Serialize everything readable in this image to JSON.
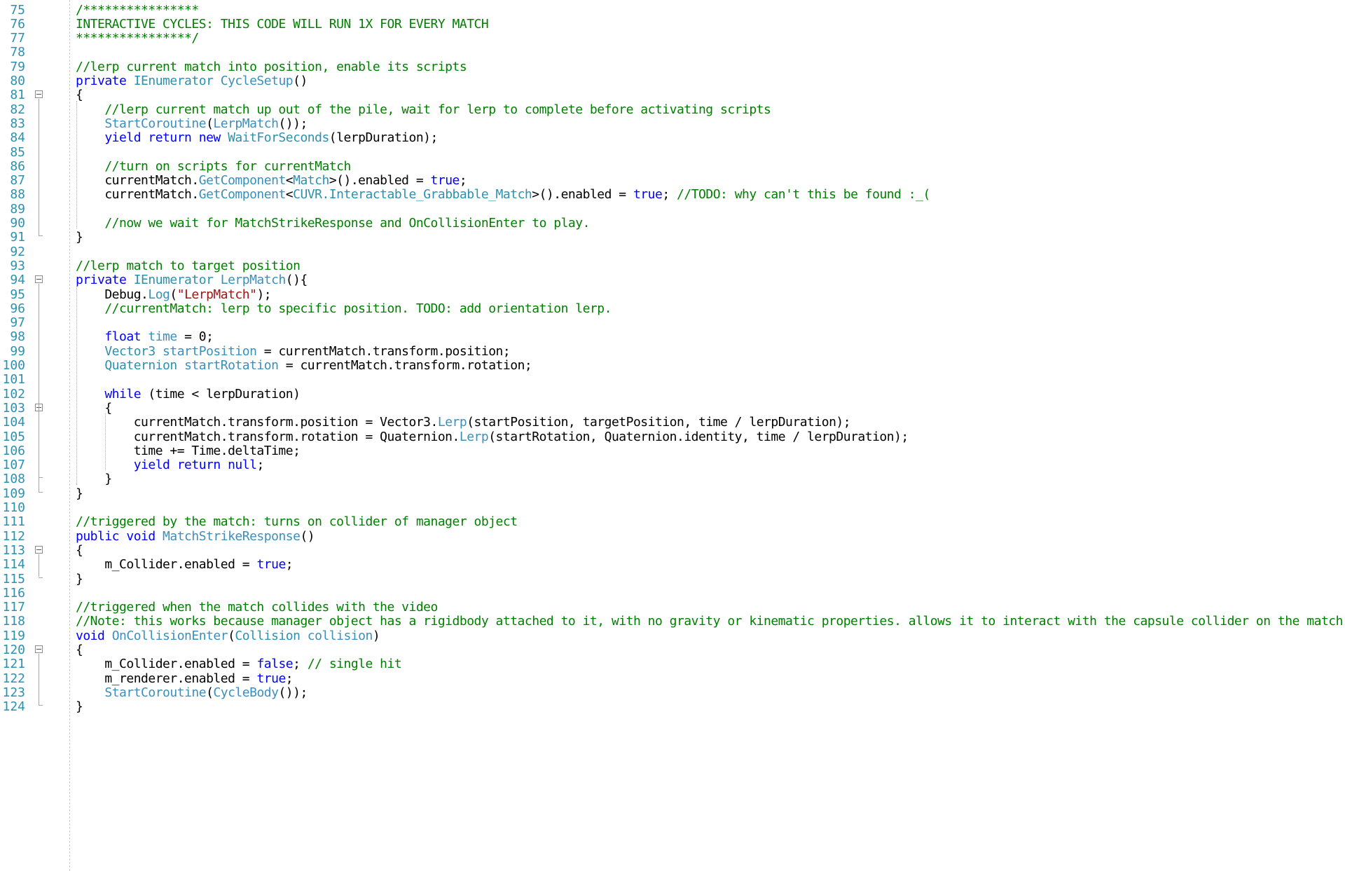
{
  "editor": {
    "lines": [
      {
        "num": "75",
        "fold": false,
        "tokens": [
          {
            "c": "c",
            "t": "/****************"
          }
        ]
      },
      {
        "num": "76",
        "fold": false,
        "tokens": [
          {
            "c": "c",
            "t": "INTERACTIVE CYCLES: THIS CODE WILL RUN 1X FOR EVERY MATCH"
          }
        ]
      },
      {
        "num": "77",
        "fold": false,
        "tokens": [
          {
            "c": "c",
            "t": "****************/"
          }
        ]
      },
      {
        "num": "78",
        "fold": false,
        "tokens": []
      },
      {
        "num": "79",
        "fold": false,
        "tokens": [
          {
            "c": "c",
            "t": "//lerp current match into position, enable its scripts"
          }
        ]
      },
      {
        "num": "80",
        "fold": false,
        "tokens": [
          {
            "c": "k",
            "t": "private "
          },
          {
            "c": "t",
            "t": "IEnumerator "
          },
          {
            "c": "m",
            "t": "CycleSetup"
          },
          {
            "c": "p",
            "t": "()"
          }
        ]
      },
      {
        "num": "81",
        "fold": true,
        "tokens": [
          {
            "c": "p",
            "t": "{"
          }
        ]
      },
      {
        "num": "82",
        "fold": false,
        "tokens": [
          {
            "c": "c",
            "t": "    //lerp current match up out of the pile, wait for lerp to complete before activating scripts"
          }
        ]
      },
      {
        "num": "83",
        "fold": false,
        "tokens": [
          {
            "c": "p",
            "t": "    "
          },
          {
            "c": "m",
            "t": "StartCoroutine"
          },
          {
            "c": "p",
            "t": "("
          },
          {
            "c": "m",
            "t": "LerpMatch"
          },
          {
            "c": "p",
            "t": "());"
          }
        ]
      },
      {
        "num": "84",
        "fold": false,
        "tokens": [
          {
            "c": "k",
            "t": "    yield return new "
          },
          {
            "c": "t",
            "t": "WaitForSeconds"
          },
          {
            "c": "p",
            "t": "(lerpDuration);"
          }
        ]
      },
      {
        "num": "85",
        "fold": false,
        "tokens": []
      },
      {
        "num": "86",
        "fold": false,
        "tokens": [
          {
            "c": "c",
            "t": "    //turn on scripts for currentMatch"
          }
        ]
      },
      {
        "num": "87",
        "fold": false,
        "tokens": [
          {
            "c": "p",
            "t": "    currentMatch."
          },
          {
            "c": "m",
            "t": "GetComponent"
          },
          {
            "c": "p",
            "t": "<"
          },
          {
            "c": "t",
            "t": "Match"
          },
          {
            "c": "p",
            "t": ">().enabled = "
          },
          {
            "c": "k",
            "t": "true"
          },
          {
            "c": "p",
            "t": ";"
          }
        ]
      },
      {
        "num": "88",
        "fold": false,
        "tokens": [
          {
            "c": "p",
            "t": "    currentMatch."
          },
          {
            "c": "m",
            "t": "GetComponent"
          },
          {
            "c": "p",
            "t": "<"
          },
          {
            "c": "t",
            "t": "CUVR.Interactable_Grabbable_Match"
          },
          {
            "c": "p",
            "t": ">().enabled = "
          },
          {
            "c": "k",
            "t": "true"
          },
          {
            "c": "p",
            "t": "; "
          },
          {
            "c": "c",
            "t": "//TODO: why can't this be found :_("
          }
        ]
      },
      {
        "num": "89",
        "fold": false,
        "tokens": []
      },
      {
        "num": "90",
        "fold": false,
        "tokens": [
          {
            "c": "c",
            "t": "    //now we wait for MatchStrikeResponse and OnCollisionEnter to play."
          }
        ]
      },
      {
        "num": "91",
        "fold": false,
        "tokens": [
          {
            "c": "p",
            "t": "}"
          }
        ]
      },
      {
        "num": "92",
        "fold": false,
        "tokens": []
      },
      {
        "num": "93",
        "fold": false,
        "tokens": [
          {
            "c": "c",
            "t": "//lerp match to target position"
          }
        ]
      },
      {
        "num": "94",
        "fold": true,
        "tokens": [
          {
            "c": "k",
            "t": "private "
          },
          {
            "c": "t",
            "t": "IEnumerator "
          },
          {
            "c": "m",
            "t": "LerpMatch"
          },
          {
            "c": "p",
            "t": "(){"
          }
        ]
      },
      {
        "num": "95",
        "fold": false,
        "tokens": [
          {
            "c": "p",
            "t": "    Debug."
          },
          {
            "c": "m",
            "t": "Log"
          },
          {
            "c": "p",
            "t": "("
          },
          {
            "c": "s",
            "t": "\"LerpMatch\""
          },
          {
            "c": "p",
            "t": ");"
          }
        ]
      },
      {
        "num": "96",
        "fold": false,
        "tokens": [
          {
            "c": "c",
            "t": "    //currentMatch: lerp to specific position. TODO: add orientation lerp."
          }
        ]
      },
      {
        "num": "97",
        "fold": false,
        "tokens": []
      },
      {
        "num": "98",
        "fold": false,
        "tokens": [
          {
            "c": "k",
            "t": "    float "
          },
          {
            "c": "m",
            "t": "time"
          },
          {
            "c": "p",
            "t": " = 0;"
          }
        ]
      },
      {
        "num": "99",
        "fold": false,
        "tokens": [
          {
            "c": "t",
            "t": "    Vector3 "
          },
          {
            "c": "m",
            "t": "startPosition"
          },
          {
            "c": "p",
            "t": " = currentMatch.transform.position;"
          }
        ]
      },
      {
        "num": "100",
        "fold": false,
        "tokens": [
          {
            "c": "t",
            "t": "    Quaternion "
          },
          {
            "c": "m",
            "t": "startRotation"
          },
          {
            "c": "p",
            "t": " = currentMatch.transform.rotation;"
          }
        ]
      },
      {
        "num": "101",
        "fold": false,
        "tokens": []
      },
      {
        "num": "102",
        "fold": false,
        "tokens": [
          {
            "c": "k",
            "t": "    while "
          },
          {
            "c": "p",
            "t": "(time < lerpDuration)"
          }
        ]
      },
      {
        "num": "103",
        "fold": true,
        "tokens": [
          {
            "c": "p",
            "t": "    {"
          }
        ]
      },
      {
        "num": "104",
        "fold": false,
        "tokens": [
          {
            "c": "p",
            "t": "        currentMatch.transform.position = Vector3."
          },
          {
            "c": "m",
            "t": "Lerp"
          },
          {
            "c": "p",
            "t": "(startPosition, targetPosition, time / lerpDuration);"
          }
        ]
      },
      {
        "num": "105",
        "fold": false,
        "tokens": [
          {
            "c": "p",
            "t": "        currentMatch.transform.rotation = Quaternion."
          },
          {
            "c": "m",
            "t": "Lerp"
          },
          {
            "c": "p",
            "t": "(startRotation, Quaternion.identity, time / lerpDuration);"
          }
        ]
      },
      {
        "num": "106",
        "fold": false,
        "tokens": [
          {
            "c": "p",
            "t": "        time += Time.deltaTime;"
          }
        ]
      },
      {
        "num": "107",
        "fold": false,
        "tokens": [
          {
            "c": "k",
            "t": "        yield return null"
          },
          {
            "c": "p",
            "t": ";"
          }
        ]
      },
      {
        "num": "108",
        "fold": false,
        "tokens": [
          {
            "c": "p",
            "t": "    }"
          }
        ]
      },
      {
        "num": "109",
        "fold": false,
        "tokens": [
          {
            "c": "p",
            "t": "}"
          }
        ]
      },
      {
        "num": "110",
        "fold": false,
        "tokens": []
      },
      {
        "num": "111",
        "fold": false,
        "tokens": [
          {
            "c": "c",
            "t": "//triggered by the match: turns on collider of manager object"
          }
        ]
      },
      {
        "num": "112",
        "fold": false,
        "tokens": [
          {
            "c": "k",
            "t": "public void "
          },
          {
            "c": "m",
            "t": "MatchStrikeResponse"
          },
          {
            "c": "p",
            "t": "()"
          }
        ]
      },
      {
        "num": "113",
        "fold": true,
        "tokens": [
          {
            "c": "p",
            "t": "{"
          }
        ]
      },
      {
        "num": "114",
        "fold": false,
        "tokens": [
          {
            "c": "p",
            "t": "    m_Collider.enabled = "
          },
          {
            "c": "k",
            "t": "true"
          },
          {
            "c": "p",
            "t": ";"
          }
        ]
      },
      {
        "num": "115",
        "fold": false,
        "tokens": [
          {
            "c": "p",
            "t": "}"
          }
        ]
      },
      {
        "num": "116",
        "fold": false,
        "tokens": []
      },
      {
        "num": "117",
        "fold": false,
        "tokens": [
          {
            "c": "c",
            "t": "//triggered when the match collides with the video"
          }
        ]
      },
      {
        "num": "118",
        "fold": false,
        "tokens": [
          {
            "c": "c",
            "t": "//Note: this works because manager object has a rigidbody attached to it, with no gravity or kinematic properties. allows it to interact with the capsule collider on the match"
          }
        ]
      },
      {
        "num": "119",
        "fold": false,
        "tokens": [
          {
            "c": "k",
            "t": "void "
          },
          {
            "c": "m",
            "t": "OnCollisionEnter"
          },
          {
            "c": "p",
            "t": "("
          },
          {
            "c": "t",
            "t": "Collision "
          },
          {
            "c": "m",
            "t": "collision"
          },
          {
            "c": "p",
            "t": ")"
          }
        ]
      },
      {
        "num": "120",
        "fold": true,
        "tokens": [
          {
            "c": "p",
            "t": "{"
          }
        ]
      },
      {
        "num": "121",
        "fold": false,
        "tokens": [
          {
            "c": "p",
            "t": "    m_Collider.enabled = "
          },
          {
            "c": "k",
            "t": "false"
          },
          {
            "c": "p",
            "t": "; "
          },
          {
            "c": "c",
            "t": "// single hit"
          }
        ]
      },
      {
        "num": "122",
        "fold": false,
        "tokens": [
          {
            "c": "p",
            "t": "    m_renderer.enabled = "
          },
          {
            "c": "k",
            "t": "true"
          },
          {
            "c": "p",
            "t": ";"
          }
        ]
      },
      {
        "num": "123",
        "fold": false,
        "tokens": [
          {
            "c": "p",
            "t": "    "
          },
          {
            "c": "m",
            "t": "StartCoroutine"
          },
          {
            "c": "p",
            "t": "("
          },
          {
            "c": "m",
            "t": "CycleBody"
          },
          {
            "c": "p",
            "t": "());"
          }
        ]
      },
      {
        "num": "124",
        "fold": false,
        "tokens": [
          {
            "c": "p",
            "t": "}"
          }
        ]
      }
    ]
  }
}
